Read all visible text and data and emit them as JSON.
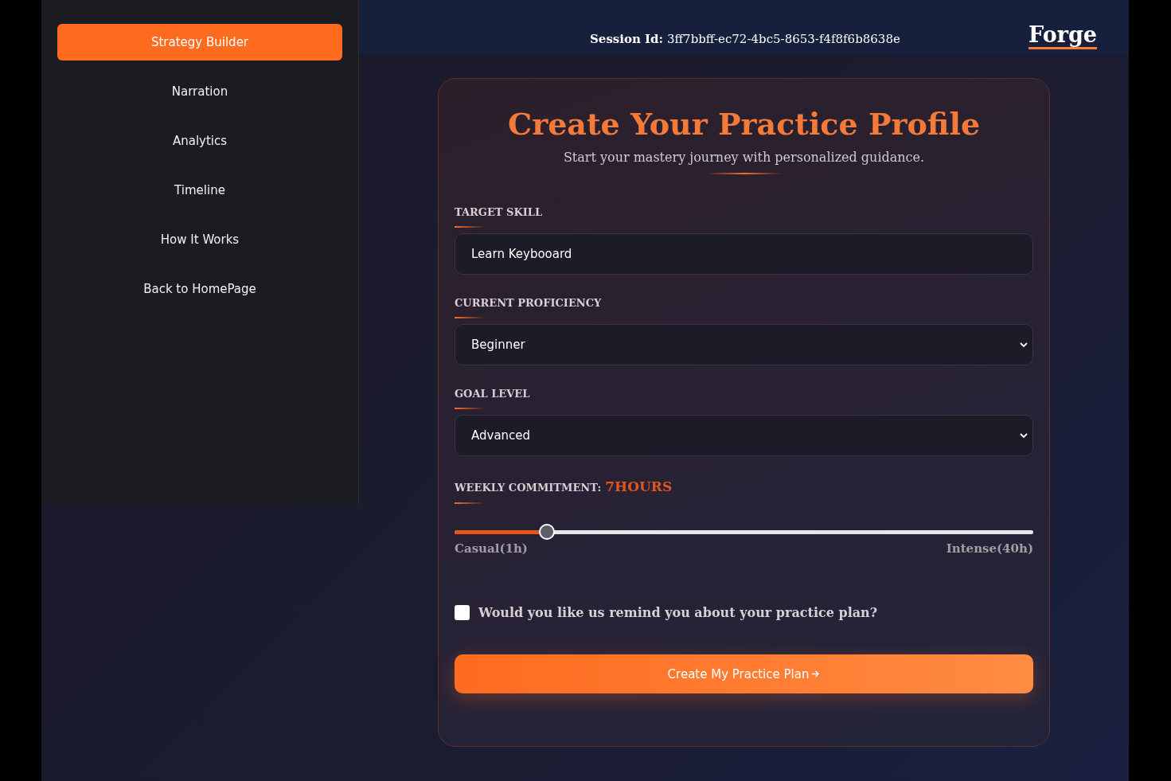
{
  "sidebar": {
    "items": [
      {
        "label": "Strategy Builder",
        "selected": true
      },
      {
        "label": "Narration",
        "selected": false
      },
      {
        "label": "Analytics",
        "selected": false
      },
      {
        "label": "Timeline",
        "selected": false
      },
      {
        "label": "How It Works",
        "selected": false
      },
      {
        "label": "Back to HomePage",
        "selected": false
      }
    ]
  },
  "header": {
    "session_label": "Session Id:",
    "session_id": "3ff7bbff-ec72-4bc5-8653-f4f8f6b8638e",
    "logo": "Forge"
  },
  "form": {
    "title": "Create Your Practice Profile",
    "subtitle": "Start your mastery journey with personalized guidance.",
    "fields": [
      {
        "kind": "text",
        "label": "TARGET SKILL",
        "value": "Learn Keybooard"
      },
      {
        "kind": "select",
        "label": "CURRENT PROFICIENCY",
        "value": "Beginner"
      },
      {
        "kind": "select",
        "label": "GOAL LEVEL",
        "value": "Advanced"
      }
    ],
    "commitment": {
      "label": "WEEKLY COMMITMENT:",
      "value": "7HOURS",
      "level": 0.16,
      "min_label": "Casual(1h)",
      "max_label": "Intense(40h)"
    },
    "reminder": {
      "label": "Would you like us remind you about your practice plan?",
      "checked": false
    },
    "submit": "Create My Practice Plan"
  }
}
